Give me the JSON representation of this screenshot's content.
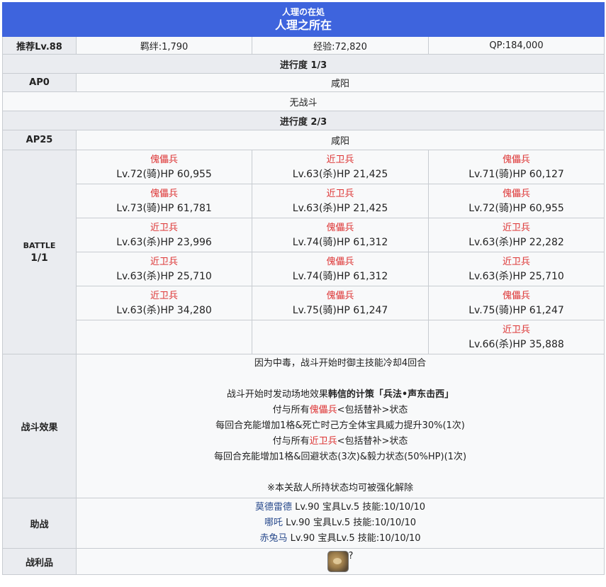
{
  "header": {
    "subtitle": "人理の在処",
    "title": "人理之所在"
  },
  "summary": {
    "recommend": "推荐Lv.88",
    "bond": "羁绊:1,790",
    "exp": "经验:72,820",
    "qp": "QP:184,000"
  },
  "stage1": {
    "progress": "进行度 1/3",
    "ap": "AP0",
    "location": "咸阳",
    "note": "无战斗"
  },
  "stage2": {
    "progress": "进行度 2/3",
    "ap": "AP25",
    "location": "咸阳",
    "battle_label": "BATTLE",
    "battle_count": "1/1",
    "enemies": [
      [
        {
          "name": "傀儡兵",
          "stat": "Lv.72(骑)HP 60,955"
        },
        {
          "name": "近卫兵",
          "stat": "Lv.63(杀)HP 21,425"
        },
        {
          "name": "傀儡兵",
          "stat": "Lv.71(骑)HP 60,127"
        }
      ],
      [
        {
          "name": "傀儡兵",
          "stat": "Lv.73(骑)HP 61,781"
        },
        {
          "name": "近卫兵",
          "stat": "Lv.63(杀)HP 21,425"
        },
        {
          "name": "傀儡兵",
          "stat": "Lv.72(骑)HP 60,955"
        }
      ],
      [
        {
          "name": "近卫兵",
          "stat": "Lv.63(杀)HP 23,996"
        },
        {
          "name": "傀儡兵",
          "stat": "Lv.74(骑)HP 61,312"
        },
        {
          "name": "近卫兵",
          "stat": "Lv.63(杀)HP 22,282"
        }
      ],
      [
        {
          "name": "近卫兵",
          "stat": "Lv.63(杀)HP 25,710"
        },
        {
          "name": "傀儡兵",
          "stat": "Lv.74(骑)HP 61,312"
        },
        {
          "name": "近卫兵",
          "stat": "Lv.63(杀)HP 25,710"
        }
      ],
      [
        {
          "name": "近卫兵",
          "stat": "Lv.63(杀)HP 34,280"
        },
        {
          "name": "傀儡兵",
          "stat": "Lv.75(骑)HP 61,247"
        },
        {
          "name": "傀儡兵",
          "stat": "Lv.75(骑)HP 61,247"
        }
      ],
      [
        {
          "name": "",
          "stat": ""
        },
        {
          "name": "",
          "stat": ""
        },
        {
          "name": "近卫兵",
          "stat": "Lv.66(杀)HP 35,888"
        }
      ]
    ]
  },
  "effects": {
    "label": "战斗效果",
    "line1": "因为中毒，战斗开始时御主技能冷却4回合",
    "line2_pre": "战斗开始时发动场地效果",
    "line2_bold": "韩信的计策「兵法•声东击西」",
    "line3_pre": "付与所有",
    "line3_red": "傀儡兵",
    "line3_post": "<包括替补>状态",
    "line4": "每回合充能增加1格&死亡时己方全体宝具威力提升30%(1次)",
    "line5_pre": "付与所有",
    "line5_red": "近卫兵",
    "line5_post": "<包括替补>状态",
    "line6": "每回合充能增加1格&回避状态(3次)&毅力状态(50%HP)(1次)",
    "line7": "※本关敌人所持状态均可被强化解除"
  },
  "support": {
    "label": "助战",
    "items": [
      {
        "name": "莫德雷德",
        "detail": " Lv.90 宝具Lv.5 技能:10/10/10"
      },
      {
        "name": "哪吒",
        "detail": " Lv.90 宝具Lv.5 技能:10/10/10"
      },
      {
        "name": "赤兔马",
        "detail": " Lv.90 宝具Lv.5 技能:10/10/10"
      }
    ]
  },
  "drops": {
    "label": "战利品",
    "icon": "material-icon",
    "suffix": "?"
  },
  "colors": {
    "header": "#3e64dd",
    "enemy": "#dd3333",
    "link": "#2a4b8d",
    "label_bg": "#eaecf0"
  }
}
